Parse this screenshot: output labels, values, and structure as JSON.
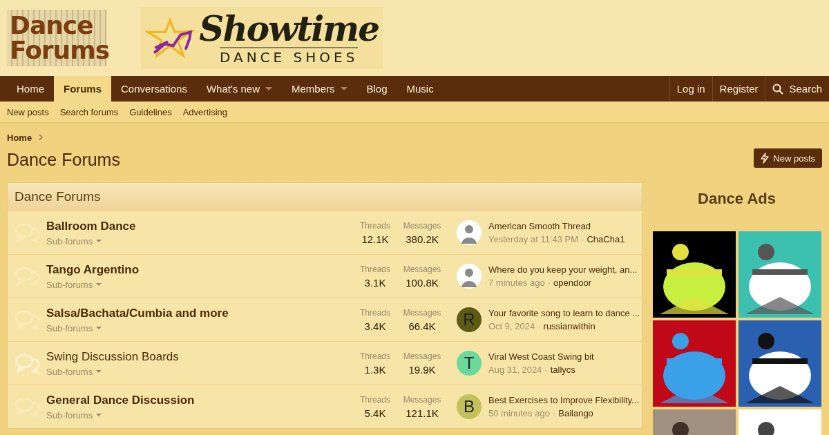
{
  "header": {
    "site_logo": [
      "Dance",
      "Forums"
    ],
    "banner": {
      "title": "Showtime",
      "subtitle": "DANCE SHOES"
    }
  },
  "nav": {
    "items": [
      {
        "label": "Home",
        "selected": false,
        "dropdown": false
      },
      {
        "label": "Forums",
        "selected": true,
        "dropdown": false
      },
      {
        "label": "Conversations",
        "selected": false,
        "dropdown": false
      },
      {
        "label": "What's new",
        "selected": false,
        "dropdown": true
      },
      {
        "label": "Members",
        "selected": false,
        "dropdown": true
      },
      {
        "label": "Blog",
        "selected": false,
        "dropdown": false
      },
      {
        "label": "Music",
        "selected": false,
        "dropdown": false
      }
    ],
    "account": [
      "Log in",
      "Register"
    ],
    "search": "Search"
  },
  "subnav": [
    "New posts",
    "Search forums",
    "Guidelines",
    "Advertising"
  ],
  "breadcrumb": [
    "Home"
  ],
  "page_title": "Dance Forums",
  "new_posts_button": "New posts",
  "category": {
    "title": "Dance Forums",
    "forums": [
      {
        "name": "Ballroom Dance",
        "unread": true,
        "subforums": "Sub-forums",
        "threads_label": "Threads",
        "threads": "12.1K",
        "messages_label": "Messages",
        "messages": "380.2K",
        "last_title": "American Smooth Thread",
        "last_time": "Yesterday at 11:43 PM",
        "separator": "·",
        "last_user": "ChaCha1"
      },
      {
        "name": "Tango Argentino",
        "unread": true,
        "subforums": "Sub-forums",
        "threads_label": "Threads",
        "threads": "3.1K",
        "messages_label": "Messages",
        "messages": "100.8K",
        "last_title": "Where do you keep your weight, an...",
        "last_time": "7 minutes ago",
        "separator": "·",
        "last_user": "opendoor"
      },
      {
        "name": "Salsa/Bachata/Cumbia and more",
        "unread": true,
        "subforums": "Sub-forums",
        "threads_label": "Threads",
        "threads": "3.4K",
        "messages_label": "Messages",
        "messages": "66.4K",
        "avatar": {
          "kind": "letter",
          "letter": "R",
          "color": "#5c5a14"
        },
        "last_title": "Your favorite song to learn to dance ...",
        "last_time": "Oct 9, 2024",
        "separator": "·",
        "last_user": "russianwithin"
      },
      {
        "name": "Swing Discussion Boards",
        "unread": false,
        "subforums": "Sub-forums",
        "threads_label": "Threads",
        "threads": "1.3K",
        "messages_label": "Messages",
        "messages": "19.9K",
        "avatar": {
          "kind": "letter",
          "letter": "T",
          "color": "#6cd89a"
        },
        "last_title": "Viral West Coast Swing bit",
        "last_time": "Aug 31, 2024",
        "separator": "·",
        "last_user": "tallycs"
      },
      {
        "name": "General Dance Discussion",
        "unread": true,
        "subforums": "Sub-forums",
        "threads_label": "Threads",
        "threads": "5.4K",
        "messages_label": "Messages",
        "messages": "121.1K",
        "avatar": {
          "kind": "letter",
          "letter": "B",
          "color": "#c2c25a"
        },
        "last_title": "Best Exercises to Improve Flexibility...",
        "last_time": "50 minutes ago",
        "separator": "·",
        "last_user": "Bailango"
      }
    ]
  },
  "sidebar": {
    "title": "Dance Ads"
  }
}
